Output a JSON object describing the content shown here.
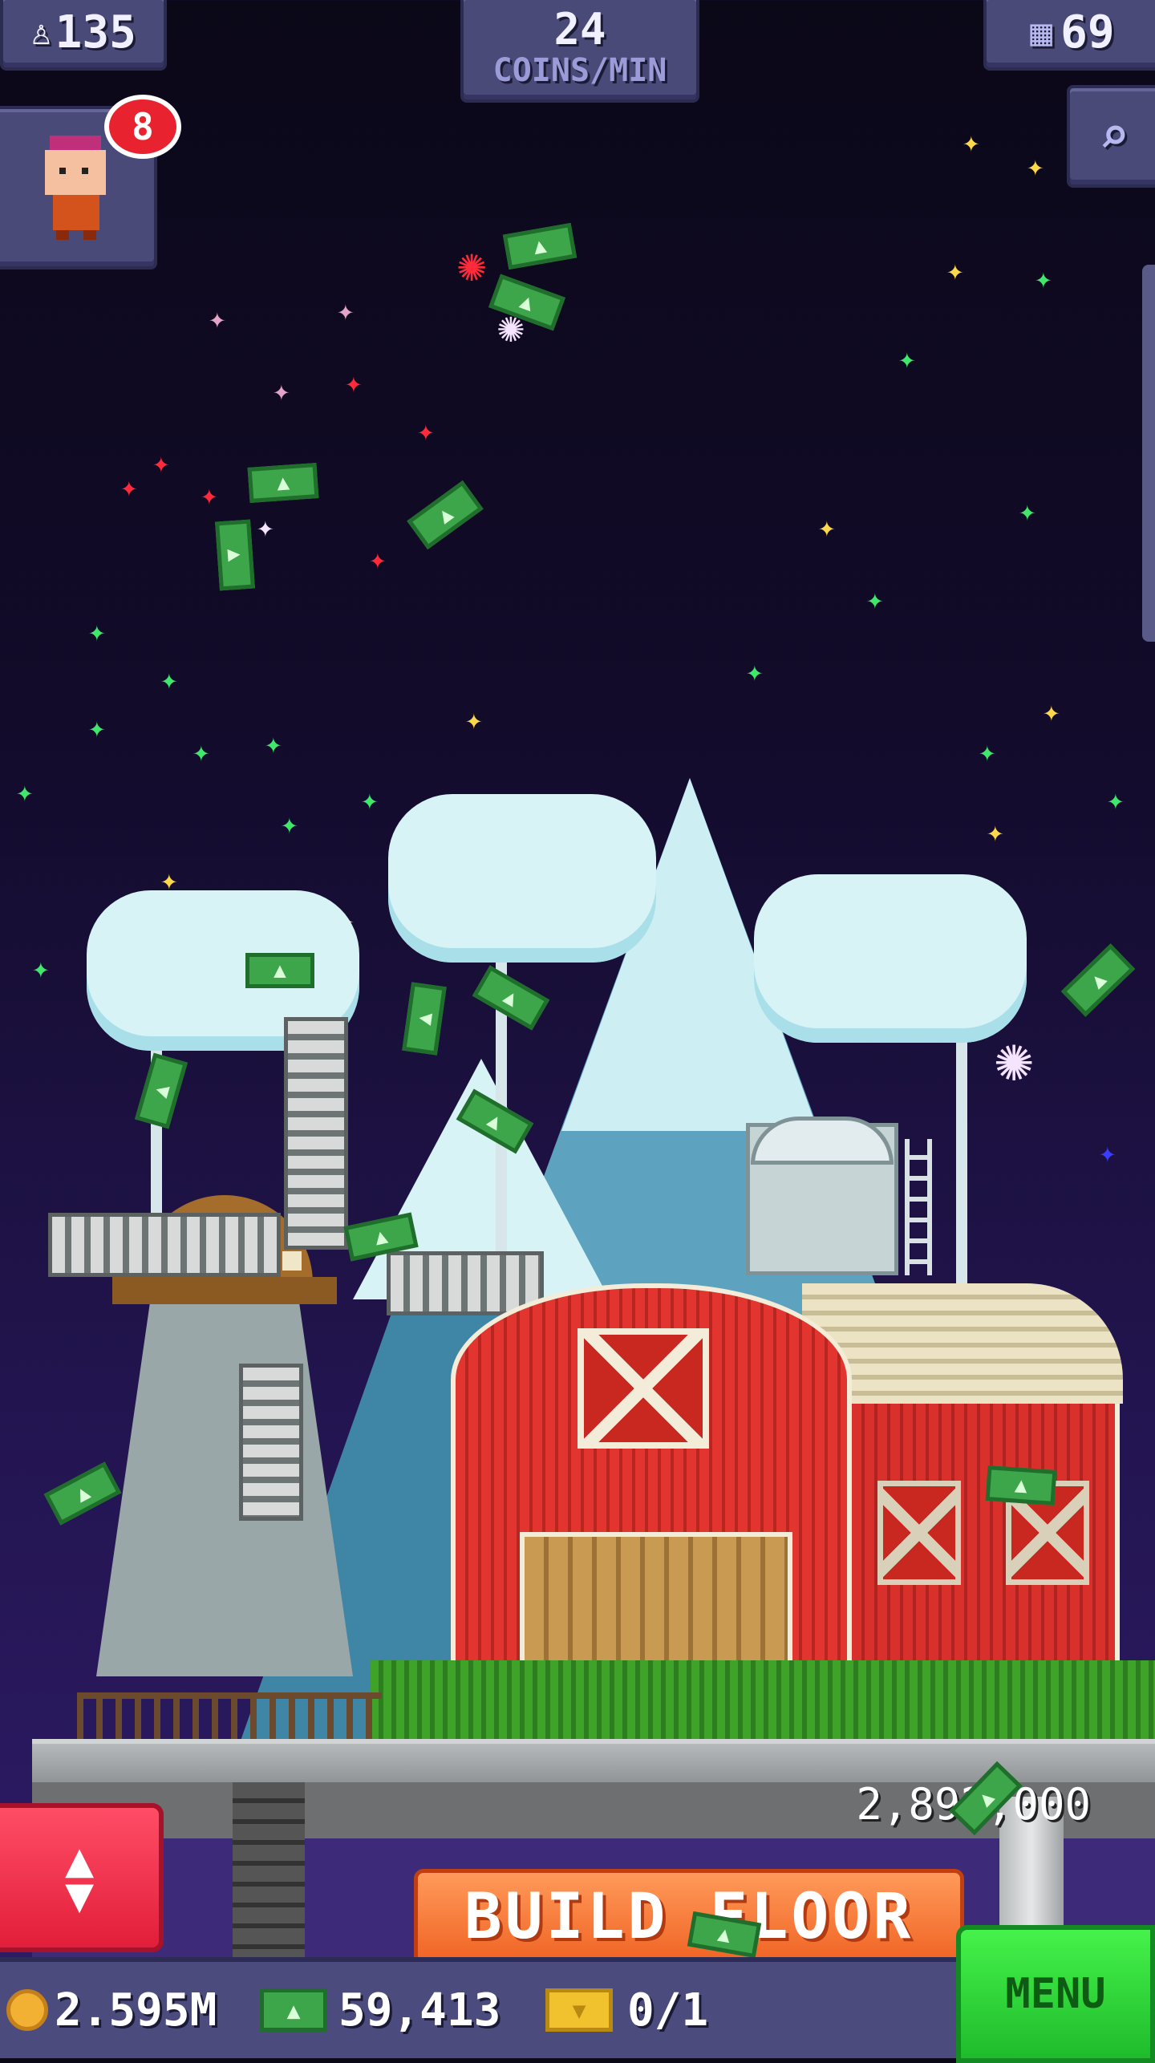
{
  "hud": {
    "population": "135",
    "coins_rate_value": "24",
    "coins_rate_unit": "COINS/MIN",
    "floors": "69",
    "notification_count": "8"
  },
  "tower": {
    "build_cost": "2,892,000",
    "build_button_label": "BUILD FLOOR"
  },
  "bottom_bar": {
    "coins": "2.595M",
    "bux": "59,413",
    "tickets": "0/1",
    "menu_label": "MENU"
  },
  "icons": {
    "population": "person-icon",
    "floors": "building-icon",
    "search": "magnifier-icon",
    "elevator": "up-down-arrows-icon",
    "coin": "coin-icon",
    "bux": "bux-bill-icon",
    "ticket": "golden-ticket-icon"
  },
  "colors": {
    "panel": "#4a4a78",
    "badge": "#e8222e",
    "build_button": "#f06424",
    "menu_button": "#2fd63a",
    "elevator_button": "#f0304a",
    "barn_red": "#d9302c",
    "bux_green": "#3da54a"
  }
}
